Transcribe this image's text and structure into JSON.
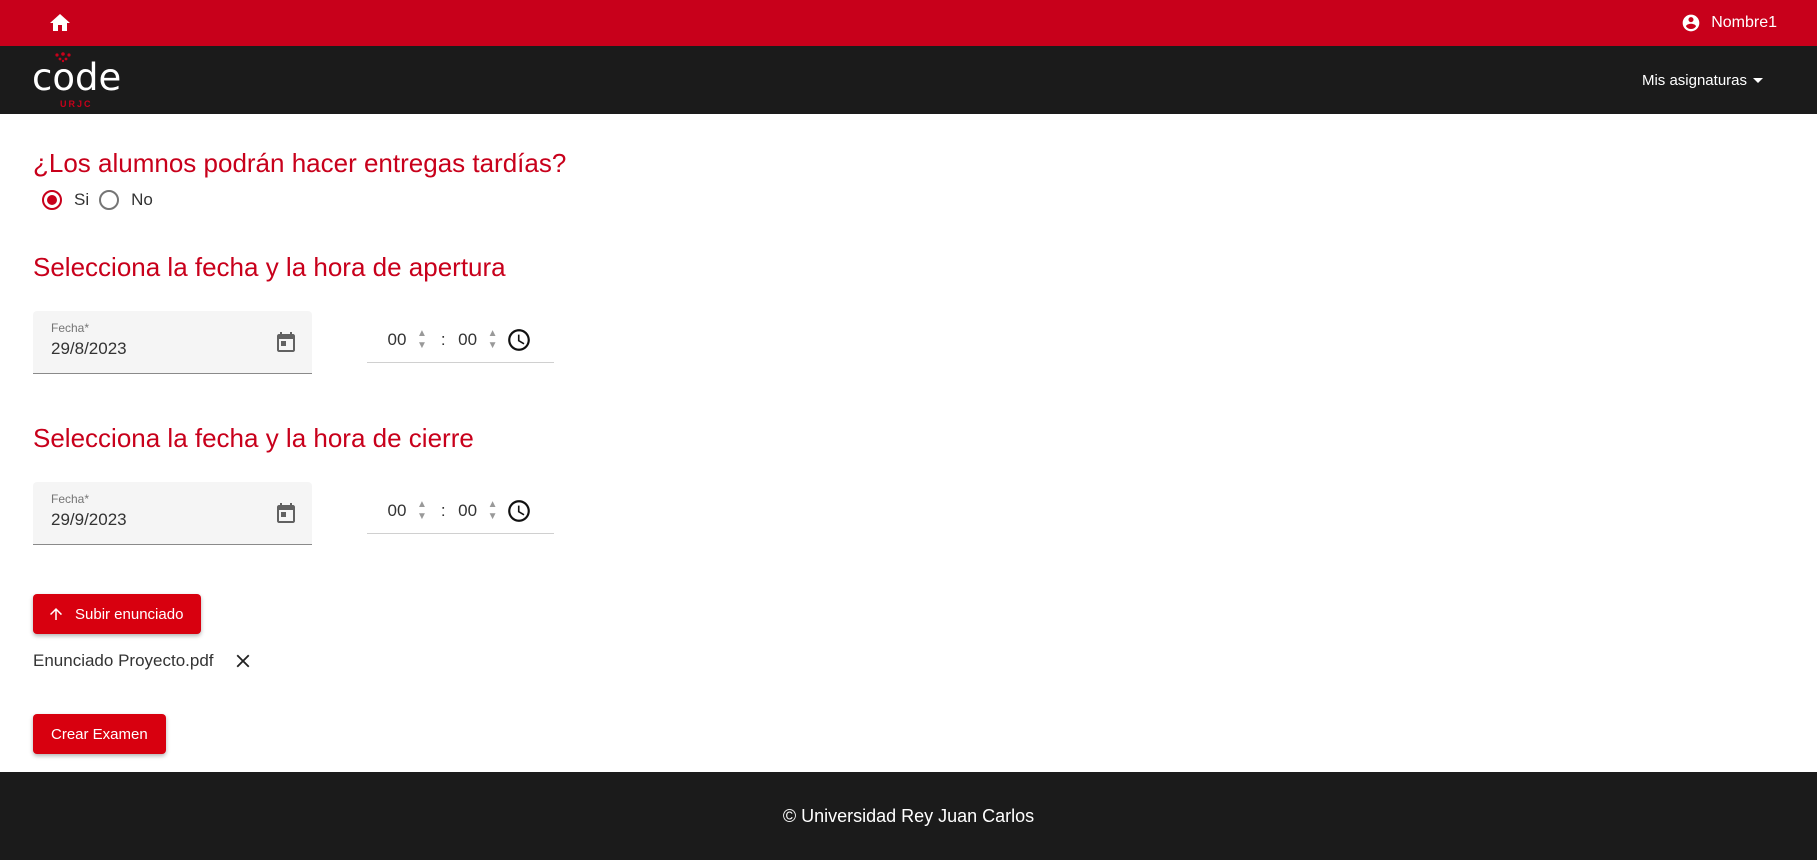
{
  "topbar": {
    "user_name": "Nombre1",
    "color": "#c8001b"
  },
  "navbar": {
    "logo_text": "code",
    "logo_subtext": "URJC",
    "menu_label": "Mis asignaturas"
  },
  "late_submissions": {
    "question": "¿Los alumnos podrán hacer entregas tardías?",
    "options": [
      {
        "label": "Si",
        "selected": true
      },
      {
        "label": "No",
        "selected": false
      }
    ]
  },
  "opening": {
    "heading": "Selecciona la fecha y la hora de apertura",
    "date_label": "Fecha*",
    "date_value": "29/8/2023",
    "hour": "00",
    "minute": "00",
    "separator": ":"
  },
  "closing": {
    "heading": "Selecciona la fecha y la hora de cierre",
    "date_label": "Fecha*",
    "date_value": "29/9/2023",
    "hour": "00",
    "minute": "00",
    "separator": ":"
  },
  "upload": {
    "button_label": "Subir enunciado",
    "file_name": "Enunciado Proyecto.pdf"
  },
  "create_button_label": "Crear Examen",
  "footer": {
    "text": "© Universidad Rey Juan Carlos"
  },
  "icons": {
    "home": "home-icon",
    "account": "account-circle-icon",
    "calendar": "calendar-icon",
    "clock": "clock-icon",
    "upload": "arrow-upward-icon",
    "close": "close-icon"
  }
}
